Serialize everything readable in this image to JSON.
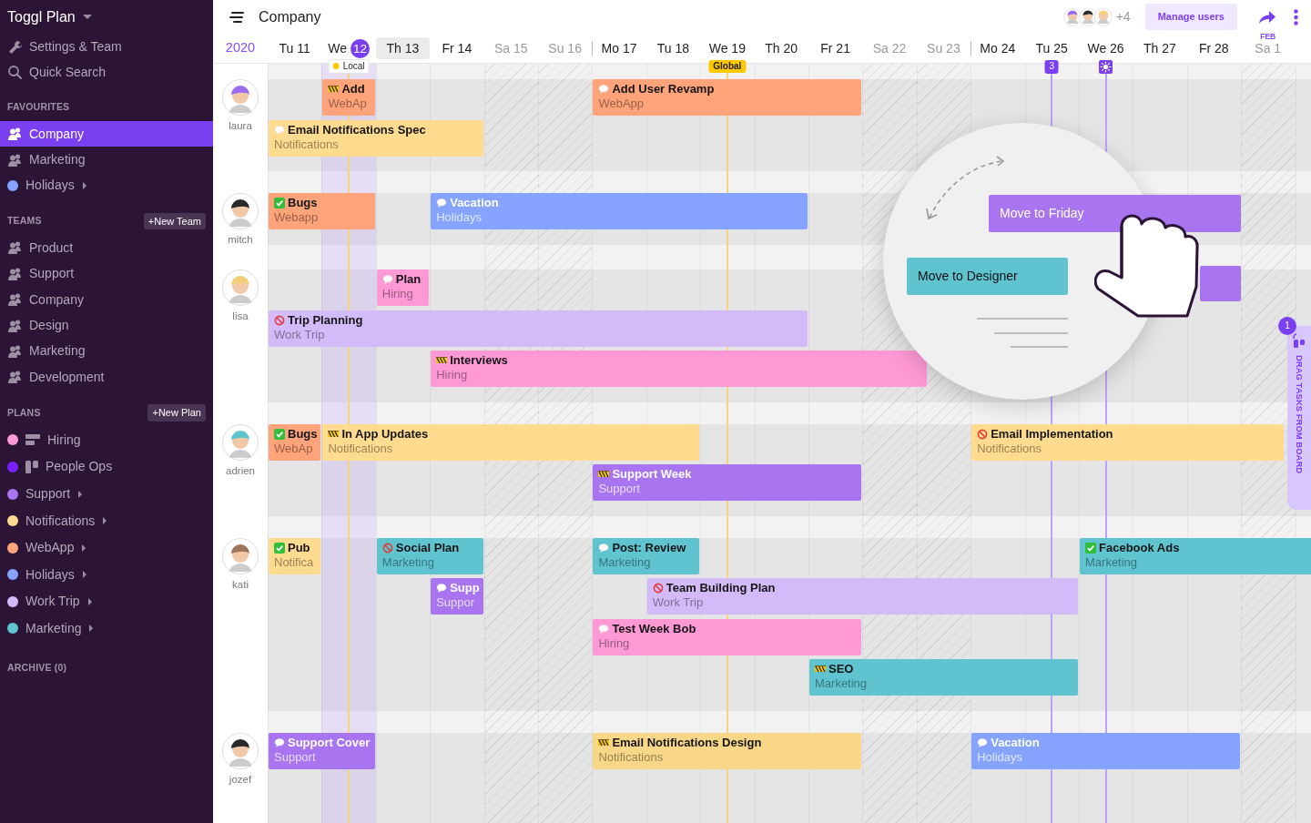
{
  "sidebar": {
    "brand": "Toggl Plan",
    "links": [
      {
        "kind": "settings",
        "label": "Settings & Team"
      },
      {
        "kind": "search",
        "label": "Quick Search"
      }
    ],
    "sections": [
      {
        "title": "FAVOURITES",
        "items": [
          {
            "label": "Company",
            "kind": "team",
            "selected": true,
            "expandable": false
          },
          {
            "label": "Marketing",
            "kind": "team",
            "selected": false,
            "expandable": false
          },
          {
            "label": "Holidays",
            "kind": "plan",
            "color": "#85a3ff",
            "selected": false,
            "expandable": true
          }
        ]
      },
      {
        "title": "TEAMS",
        "button": "+New Team",
        "items": [
          {
            "label": "Product",
            "kind": "team",
            "selected": false,
            "expandable": false
          },
          {
            "label": "Support",
            "kind": "team",
            "selected": false,
            "expandable": false
          },
          {
            "label": "Company",
            "kind": "team",
            "selected": false,
            "expandable": false
          },
          {
            "label": "Design",
            "kind": "team",
            "selected": false,
            "expandable": false
          },
          {
            "label": "Marketing",
            "kind": "team",
            "selected": false,
            "expandable": false
          },
          {
            "label": "Development",
            "kind": "team",
            "selected": false,
            "expandable": false
          }
        ]
      },
      {
        "title": "PLANS",
        "button": "+New Plan",
        "items": [
          {
            "label": "Hiring",
            "kind": "timeline_plan",
            "color": "#ff99d6",
            "selected": false,
            "expandable": false
          },
          {
            "label": "People Ops",
            "kind": "board_plan",
            "color": "#7b1fff",
            "selected": false,
            "expandable": false
          },
          {
            "label": "Support",
            "kind": "plan",
            "color": "#a874f0",
            "selected": false,
            "expandable": true
          },
          {
            "label": "Notifications",
            "kind": "plan",
            "color": "#ffdb8f",
            "selected": false,
            "expandable": true
          },
          {
            "label": "WebApp",
            "kind": "plan",
            "color": "#ffa37a",
            "selected": false,
            "expandable": true
          },
          {
            "label": "Holidays",
            "kind": "plan",
            "color": "#85a3ff",
            "selected": false,
            "expandable": true
          },
          {
            "label": "Work Trip",
            "kind": "plan",
            "color": "#d3bbfa",
            "selected": false,
            "expandable": true
          },
          {
            "label": "Marketing",
            "kind": "plan",
            "color": "#5fc4cf",
            "selected": false,
            "expandable": true
          }
        ]
      }
    ],
    "archive": "ARCHIVE (0)"
  },
  "header": {
    "title": "Company",
    "more_users": "+4",
    "manage_button": "Manage users"
  },
  "dates": {
    "year": "2020",
    "days": [
      {
        "label": "Tu 11",
        "weekend": false,
        "selected": false,
        "week_start": false
      },
      {
        "label": "We",
        "today_date": "12",
        "weekend": false,
        "selected": false,
        "week_start": false,
        "marker": {
          "kind": "local",
          "label": "Local"
        }
      },
      {
        "label": "Th 13",
        "weekend": false,
        "selected": true,
        "week_start": false
      },
      {
        "label": "Fr 14",
        "weekend": false,
        "selected": false,
        "week_start": false
      },
      {
        "label": "Sa 15",
        "weekend": true,
        "selected": false,
        "week_start": false
      },
      {
        "label": "Su 16",
        "weekend": true,
        "selected": false,
        "week_start": false
      },
      {
        "label": "Mo 17",
        "weekend": false,
        "selected": false,
        "week_start": true
      },
      {
        "label": "Tu 18",
        "weekend": false,
        "selected": false,
        "week_start": false
      },
      {
        "label": "We 19",
        "weekend": false,
        "selected": false,
        "week_start": false,
        "marker": {
          "kind": "global",
          "label": "Global"
        }
      },
      {
        "label": "Th 20",
        "weekend": false,
        "selected": false,
        "week_start": false
      },
      {
        "label": "Fr 21",
        "weekend": false,
        "selected": false,
        "week_start": false
      },
      {
        "label": "Sa 22",
        "weekend": true,
        "selected": false,
        "week_start": false
      },
      {
        "label": "Su 23",
        "weekend": true,
        "selected": false,
        "week_start": false
      },
      {
        "label": "Mo 24",
        "weekend": false,
        "selected": false,
        "week_start": true
      },
      {
        "label": "Tu 25",
        "weekend": false,
        "selected": false,
        "week_start": false,
        "marker": {
          "kind": "count",
          "label": "3"
        }
      },
      {
        "label": "We 26",
        "weekend": false,
        "selected": false,
        "week_start": false,
        "marker": {
          "kind": "sun"
        }
      },
      {
        "label": "Th 27",
        "weekend": false,
        "selected": false,
        "week_start": false
      },
      {
        "label": "Fr 28",
        "weekend": false,
        "selected": false,
        "week_start": false
      },
      {
        "label": "Sa 1",
        "month": "FEB",
        "weekend": true,
        "selected": false,
        "week_start": false
      }
    ]
  },
  "people": [
    {
      "name": "laura",
      "tasks": [
        {
          "title": "Add",
          "plan": "WebAp",
          "color": "#ffa37a",
          "kind": "in_progress"
        },
        {
          "title": "Add User Revamp",
          "plan": "WebApp",
          "color": "#ffa37a",
          "kind": "comment"
        },
        {
          "title": "Email Notifications Spec",
          "plan": "Notifications",
          "color": "#ffdb8f",
          "kind": "comment"
        }
      ]
    },
    {
      "name": "mitch",
      "tasks": [
        {
          "title": "Bugs",
          "plan": "Webapp",
          "color": "#ffa37a",
          "kind": "done"
        },
        {
          "title": "Vacation",
          "plan": "Holidays",
          "color": "#85a3ff",
          "kind": "comment"
        }
      ]
    },
    {
      "name": "lisa",
      "tasks": [
        {
          "title": "Plan",
          "plan": "Hiring",
          "color": "#ff99d6",
          "kind": "comment"
        },
        {
          "title": "Trip Planning",
          "plan": "Work Trip",
          "color": "#d3bbfa",
          "kind": "blocked"
        },
        {
          "title": "Interviews",
          "plan": "Hiring",
          "color": "#ff99d6",
          "kind": "in_progress"
        }
      ]
    },
    {
      "name": "adrien",
      "tasks": [
        {
          "title": "Bugs",
          "plan": "WebAp",
          "color": "#ffa37a",
          "kind": "done"
        },
        {
          "title": "In App Updates",
          "plan": "Notifications",
          "color": "#ffdb8f",
          "kind": "in_progress"
        },
        {
          "title": "Email Implementation",
          "plan": "Notifications",
          "color": "#ffdb8f",
          "kind": "blocked"
        },
        {
          "title": "Support Week",
          "plan": "Support",
          "color": "#a874f0",
          "kind": "in_progress"
        }
      ]
    },
    {
      "name": "kati",
      "tasks": [
        {
          "title": "Pub",
          "plan": "Notifica",
          "color": "#ffdb8f",
          "kind": "done"
        },
        {
          "title": "Social Plan",
          "plan": "Marketing",
          "color": "#5fc4cf",
          "kind": "blocked"
        },
        {
          "title": "Post: Review",
          "plan": "Marketing",
          "color": "#5fc4cf",
          "kind": "comment"
        },
        {
          "title": "Facebook Ads",
          "plan": "Marketing",
          "color": "#5fc4cf",
          "kind": "done"
        },
        {
          "title": "Supp",
          "plan": "Suppor",
          "color": "#a874f0",
          "kind": "comment"
        },
        {
          "title": "Team Building Plan",
          "plan": "Work Trip",
          "color": "#d3bbfa",
          "kind": "blocked"
        },
        {
          "title": "Test Week Bob",
          "plan": "Hiring",
          "color": "#ff99d6",
          "kind": "comment"
        },
        {
          "title": "SEO",
          "plan": "Marketing",
          "color": "#5fc4cf",
          "kind": "in_progress"
        }
      ]
    },
    {
      "name": "jozef",
      "tasks": [
        {
          "title": "Support Cover",
          "plan": "Support",
          "color": "#a874f0",
          "kind": "comment"
        },
        {
          "title": "Email Notifications Design",
          "plan": "Notifications",
          "color": "#f9d788",
          "kind": "in_progress"
        },
        {
          "title": "Vacation",
          "plan": "Holidays",
          "color": "#85a3ff",
          "kind": "comment"
        }
      ]
    }
  ],
  "tutorial": {
    "drag_task": "Move to Friday",
    "drop_task": "Move to Designer"
  },
  "board_tab": {
    "label": "DRAG TASKS FROM BOARD",
    "count": "1"
  }
}
